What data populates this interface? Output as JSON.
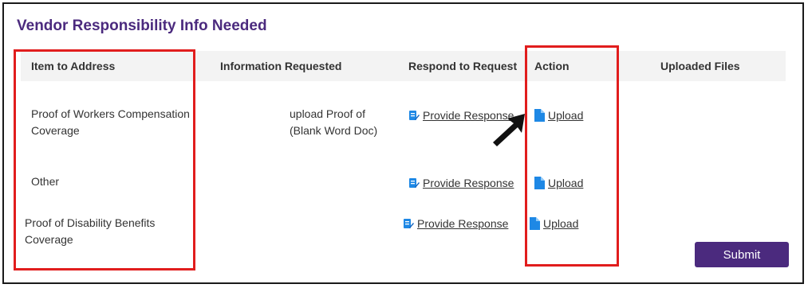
{
  "title": "Vendor Responsibility Info Needed",
  "columns": [
    "Item to Address",
    "Information Requested",
    "Respond to Request",
    "Action",
    "Uploaded Files"
  ],
  "rows": [
    {
      "item_line1": "Proof of Workers Compensation",
      "item_line2": "Coverage",
      "info_line1": "upload Proof of",
      "info_line2": "(Blank Word Doc)",
      "respond": "Provide Response",
      "action": "Upload"
    },
    {
      "item_line1": "Other",
      "respond": "Provide Response",
      "action": "Upload"
    },
    {
      "item_line1": "Proof of Disability Benefits",
      "item_line2": "Coverage",
      "respond": "Provide Response",
      "action": "Upload"
    }
  ],
  "submit_label": "Submit",
  "icons": {
    "respond": "edit-document-icon",
    "action": "file-icon",
    "pointer": "pointer-arrow-icon"
  },
  "colors": {
    "accent": "#4b2a7e",
    "link_icon": "#1e88e5",
    "highlight": "#e11d1d"
  }
}
